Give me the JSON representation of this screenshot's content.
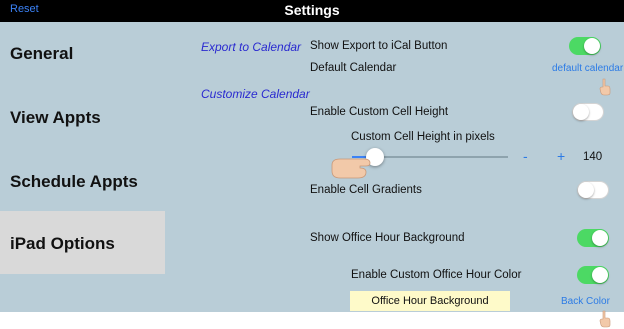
{
  "header": {
    "reset_label": "Reset",
    "title": "Settings"
  },
  "sidebar": {
    "items": [
      {
        "label": "General",
        "active": false
      },
      {
        "label": "View Appts",
        "active": false
      },
      {
        "label": "Schedule Appts",
        "active": false
      },
      {
        "label": "iPad Options",
        "active": true
      }
    ]
  },
  "main": {
    "export_link": "Export to Calendar",
    "customize_link": "Customize Calendar",
    "show_export_label": "Show Export to iCal Button",
    "show_export_on": true,
    "default_calendar_label": "Default Calendar",
    "default_calendar_value": "default calendar",
    "custom_cell_height_label": "Enable Custom Cell Height",
    "custom_cell_height_on": false,
    "cell_height_pixels_label": "Custom Cell Height in pixels",
    "cell_height_slider_fraction": 0.15,
    "stepper_minus": "-",
    "stepper_plus": "+",
    "cell_height_value": "140",
    "cell_gradients_label": "Enable Cell Gradients",
    "cell_gradients_on": false,
    "office_hour_bg_label": "Show Office Hour Background",
    "office_hour_bg_on": true,
    "custom_office_color_label": "Enable Custom Office Hour Color",
    "custom_office_color_on": true,
    "office_hour_swatch_label": "Office Hour Background",
    "office_hour_swatch_color": "#fefac9",
    "back_color_label": "Back Color"
  },
  "colors": {
    "toggle_on": "#4cd964",
    "link_blue": "#2c7be5",
    "italic_link": "#2a2ad0",
    "content_bg": "#b9cdd7"
  }
}
